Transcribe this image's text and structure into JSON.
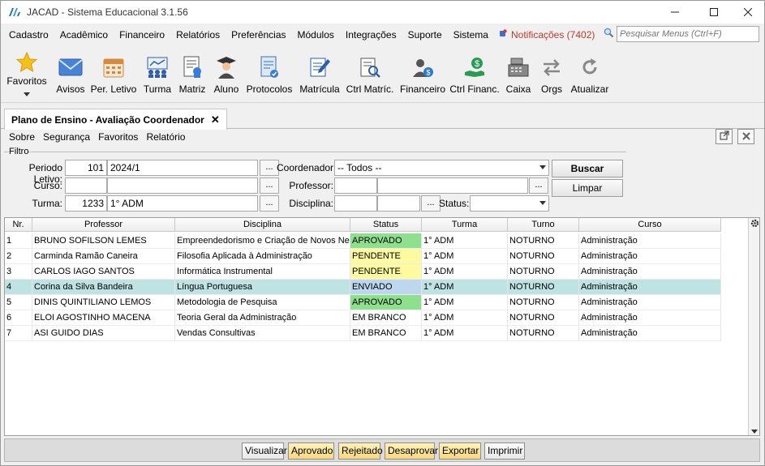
{
  "window": {
    "title": "JACAD - Sistema Educacional 3.1.56",
    "controls": [
      "minimize",
      "maximize",
      "close"
    ]
  },
  "menubar": {
    "items": [
      "Cadastro",
      "Acadêmico",
      "Financeiro",
      "Relatórios",
      "Preferências",
      "Módulos",
      "Integrações",
      "Suporte",
      "Sistema"
    ],
    "notifications": "Notificações (7402)",
    "search_placeholder": "Pesquisar Menus (Ctrl+F)"
  },
  "toolbar": {
    "items": [
      {
        "label": "Favoritos",
        "icon": "star-icon"
      },
      {
        "label": "Avisos",
        "icon": "envelope-icon"
      },
      {
        "label": "Per. Letivo",
        "icon": "calendar-icon"
      },
      {
        "label": "Turma",
        "icon": "class-group-icon"
      },
      {
        "label": "Matriz",
        "icon": "matrix-document-icon"
      },
      {
        "label": "Aluno",
        "icon": "graduate-student-icon"
      },
      {
        "label": "Protocolos",
        "icon": "protocol-document-icon"
      },
      {
        "label": "Matrícula",
        "icon": "enrollment-edit-icon"
      },
      {
        "label": "Ctrl Matríc.",
        "icon": "enrollment-control-icon"
      },
      {
        "label": "Financeiro",
        "icon": "finance-user-icon"
      },
      {
        "label": "Ctrl Financ.",
        "icon": "finance-control-icon"
      },
      {
        "label": "Caixa",
        "icon": "cash-register-icon"
      },
      {
        "label": "Orgs",
        "icon": "swap-arrows-icon"
      },
      {
        "label": "Atualizar",
        "icon": "refresh-icon"
      }
    ]
  },
  "tab": {
    "label": "Plano de Ensino - Avaliação Coordenador",
    "close": "✕"
  },
  "submenu": {
    "items": [
      "Sobre",
      "Segurança",
      "Favoritos",
      "Relatório"
    ]
  },
  "filter": {
    "legend": "Filtro",
    "periodo_label": "Periodo Letivo:",
    "periodo_code": "101",
    "periodo_name": "2024/1",
    "curso_label": "Curso:",
    "curso_code": "",
    "curso_name": "",
    "turma_label": "Turma:",
    "turma_code": "1233",
    "turma_name": "1° ADM",
    "coordenador_label": "Coordenador:",
    "coordenador_value": "-- Todos --",
    "professor_label": "Professor:",
    "professor_code": "",
    "professor_name": "",
    "disciplina_label": "Disciplina:",
    "disciplina_code": "",
    "disciplina_name": "",
    "status_label": "Status:",
    "status_value": "",
    "lookup_label": "...",
    "buscar_label": "Buscar",
    "limpar_label": "Limpar"
  },
  "grid": {
    "columns": [
      "Nr.",
      "Professor",
      "Disciplina",
      "Status",
      "Turma",
      "Turno",
      "Curso"
    ],
    "rows": [
      {
        "nr": "1",
        "professor": "BRUNO SOFILSON LEMES",
        "disciplina": "Empreendedorismo e Criação de Novos Ne...",
        "status": "APROVADO",
        "turma": "1° ADM",
        "turno": "NOTURNO",
        "curso": "Administração"
      },
      {
        "nr": "2",
        "professor": "Carminda Ramão Caneira",
        "disciplina": "Filosofia Aplicada à Administração",
        "status": "PENDENTE",
        "turma": "1° ADM",
        "turno": "NOTURNO",
        "curso": "Administração"
      },
      {
        "nr": "3",
        "professor": "CARLOS IAGO SANTOS",
        "disciplina": "Informática Instrumental",
        "status": "PENDENTE",
        "turma": "1° ADM",
        "turno": "NOTURNO",
        "curso": "Administração"
      },
      {
        "nr": "4",
        "professor": "Corina da Silva Bandeira",
        "disciplina": "Língua Portuguesa",
        "status": "ENVIADO",
        "turma": "1° ADM",
        "turno": "NOTURNO",
        "curso": "Administração"
      },
      {
        "nr": "5",
        "professor": "DINIS QUINTILIANO LEMOS",
        "disciplina": "Metodologia de Pesquisa",
        "status": "APROVADO",
        "turma": "1° ADM",
        "turno": "NOTURNO",
        "curso": "Administração"
      },
      {
        "nr": "6",
        "professor": "ELOI AGOSTINHO MACENA",
        "disciplina": "Teoria Geral da Administração",
        "status": "EM BRANCO",
        "turma": "1° ADM",
        "turno": "NOTURNO",
        "curso": "Administração"
      },
      {
        "nr": "7",
        "professor": "ASI GUIDO DIAS",
        "disciplina": "Vendas Consultivas",
        "status": "EM BRANCO",
        "turma": "1° ADM",
        "turno": "NOTURNO",
        "curso": "Administração"
      }
    ],
    "selected_row": 4
  },
  "bottom": {
    "visualizar": "Visualizar",
    "aprovado": "Aprovado",
    "rejeitado": "Rejeitado",
    "desaprovar": "Desaprovar",
    "exportar": "Exportar",
    "imprimir": "Imprimir"
  },
  "colors": {
    "aprovado": "#8ee08e",
    "pendente": "#fdfaa0",
    "enviado": "#bcd7ee",
    "selected_row": "#bfe3e3",
    "notification": "#c0392b"
  }
}
